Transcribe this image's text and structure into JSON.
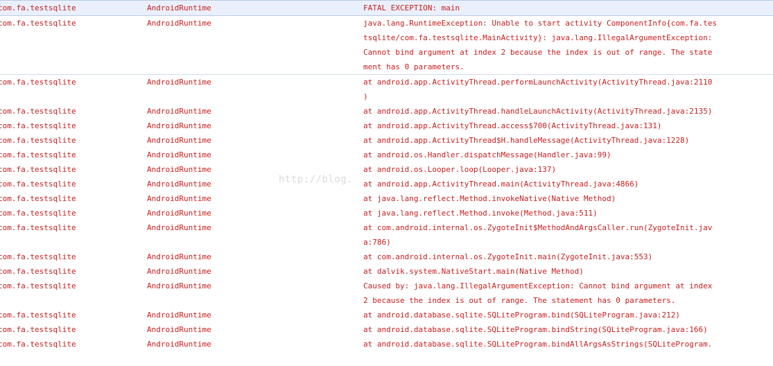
{
  "log": {
    "rows": [
      {
        "app": "com.fa.testsqlite",
        "tag": "AndroidRuntime",
        "lines": [
          "FATAL EXCEPTION: main"
        ],
        "wraps": [
          false
        ],
        "state": "selected"
      },
      {
        "app": "com.fa.testsqlite",
        "tag": "AndroidRuntime",
        "lines": [
          "java.lang.RuntimeException: Unable to start activity ComponentInfo{com.fa.tes",
          "tsqlite/com.fa.testsqlite.MainActivity}: java.lang.IllegalArgumentException:",
          "Cannot bind argument at index 2 because the index is out of range.  The state",
          "ment has 0 parameters."
        ],
        "wraps": [
          true,
          true,
          true,
          false
        ],
        "state": "hover"
      },
      {
        "app": "com.fa.testsqlite",
        "tag": "AndroidRuntime",
        "lines": [
          "at android.app.ActivityThread.performLaunchActivity(ActivityThread.java:2110",
          ")"
        ],
        "wraps": [
          true,
          false
        ],
        "state": ""
      },
      {
        "app": "com.fa.testsqlite",
        "tag": "AndroidRuntime",
        "lines": [
          "at android.app.ActivityThread.handleLaunchActivity(ActivityThread.java:2135)"
        ],
        "wraps": [
          false
        ],
        "state": ""
      },
      {
        "app": "com.fa.testsqlite",
        "tag": "AndroidRuntime",
        "lines": [
          "at android.app.ActivityThread.access$700(ActivityThread.java:131)"
        ],
        "wraps": [
          false
        ],
        "state": ""
      },
      {
        "app": "com.fa.testsqlite",
        "tag": "AndroidRuntime",
        "lines": [
          "at android.app.ActivityThread$H.handleMessage(ActivityThread.java:1228)"
        ],
        "wraps": [
          false
        ],
        "state": ""
      },
      {
        "app": "com.fa.testsqlite",
        "tag": "AndroidRuntime",
        "lines": [
          "at android.os.Handler.dispatchMessage(Handler.java:99)"
        ],
        "wraps": [
          false
        ],
        "state": ""
      },
      {
        "app": "com.fa.testsqlite",
        "tag": "AndroidRuntime",
        "lines": [
          "at android.os.Looper.loop(Looper.java:137)"
        ],
        "wraps": [
          false
        ],
        "state": ""
      },
      {
        "app": "com.fa.testsqlite",
        "tag": "AndroidRuntime",
        "lines": [
          "at android.app.ActivityThread.main(ActivityThread.java:4866)"
        ],
        "wraps": [
          false
        ],
        "state": ""
      },
      {
        "app": "com.fa.testsqlite",
        "tag": "AndroidRuntime",
        "lines": [
          "at java.lang.reflect.Method.invokeNative(Native Method)"
        ],
        "wraps": [
          false
        ],
        "state": ""
      },
      {
        "app": "com.fa.testsqlite",
        "tag": "AndroidRuntime",
        "lines": [
          "at java.lang.reflect.Method.invoke(Method.java:511)"
        ],
        "wraps": [
          false
        ],
        "state": ""
      },
      {
        "app": "com.fa.testsqlite",
        "tag": "AndroidRuntime",
        "lines": [
          "at com.android.internal.os.ZygoteInit$MethodAndArgsCaller.run(ZygoteInit.jav",
          "a:786)"
        ],
        "wraps": [
          true,
          false
        ],
        "state": ""
      },
      {
        "app": "com.fa.testsqlite",
        "tag": "AndroidRuntime",
        "lines": [
          "at com.android.internal.os.ZygoteInit.main(ZygoteInit.java:553)"
        ],
        "wraps": [
          false
        ],
        "state": ""
      },
      {
        "app": "com.fa.testsqlite",
        "tag": "AndroidRuntime",
        "lines": [
          "at dalvik.system.NativeStart.main(Native Method)"
        ],
        "wraps": [
          false
        ],
        "state": ""
      },
      {
        "app": "com.fa.testsqlite",
        "tag": "AndroidRuntime",
        "lines": [
          "Caused by: java.lang.IllegalArgumentException: Cannot bind argument at index",
          "2 because the index is out of range.  The statement has 0 parameters."
        ],
        "wraps": [
          true,
          false
        ],
        "state": ""
      },
      {
        "app": "com.fa.testsqlite",
        "tag": "AndroidRuntime",
        "lines": [
          "at android.database.sqlite.SQLiteProgram.bind(SQLiteProgram.java:212)"
        ],
        "wraps": [
          false
        ],
        "state": ""
      },
      {
        "app": "com.fa.testsqlite",
        "tag": "AndroidRuntime",
        "lines": [
          "at android.database.sqlite.SQLiteProgram.bindString(SQLiteProgram.java:166)"
        ],
        "wraps": [
          false
        ],
        "state": ""
      },
      {
        "app": "com.fa.testsqlite",
        "tag": "AndroidRuntime",
        "lines": [
          "at android.database.sqlite.SQLiteProgram.bindAllArgsAsStrings(SQLiteProgram.",
          ""
        ],
        "wraps": [
          true,
          false
        ],
        "state": ""
      }
    ]
  },
  "watermark": {
    "text": "http://blog."
  },
  "colors": {
    "text": "#c81d1d",
    "selected_background": "#eaf0fb",
    "selected_border": "#b9cbe8"
  }
}
